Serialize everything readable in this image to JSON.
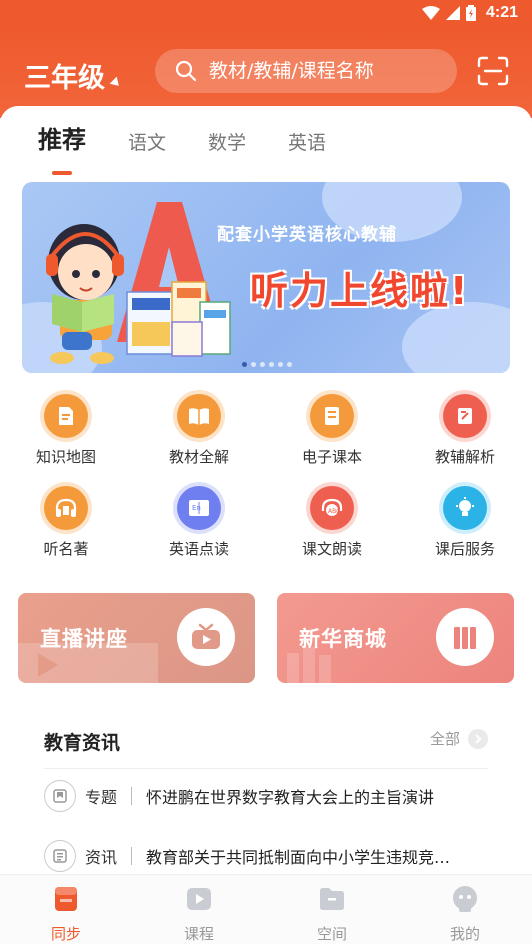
{
  "status_bar": {
    "time": "4:21"
  },
  "header": {
    "grade": "三年级",
    "search_placeholder": "教材/教辅/课程名称"
  },
  "tabs": [
    "推荐",
    "语文",
    "数学",
    "英语"
  ],
  "banner": {
    "subtitle": "配套小学英语核心教辅",
    "title": "听力上线啦!"
  },
  "quick_actions": [
    {
      "label": "知识地图",
      "icon": "knowledge-map-icon",
      "color": "#f59a3b"
    },
    {
      "label": "教材全解",
      "icon": "textbook-explain-icon",
      "color": "#f59a3b"
    },
    {
      "label": "电子课本",
      "icon": "ebook-icon",
      "color": "#f59a3b"
    },
    {
      "label": "教辅解析",
      "icon": "tutorial-analysis-icon",
      "color": "#ef5f4f"
    },
    {
      "label": "听名著",
      "icon": "audiobook-icon",
      "color": "#f59a3b"
    },
    {
      "label": "英语点读",
      "icon": "english-reading-icon",
      "color": "#6f7ff0"
    },
    {
      "label": "课文朗读",
      "icon": "text-recital-icon",
      "color": "#ef5f4f"
    },
    {
      "label": "课后服务",
      "icon": "after-school-service-icon",
      "color": "#2bb3e8"
    }
  ],
  "promos": [
    {
      "label": "直播讲座",
      "icon": "live-tv-icon",
      "color": "#e59a86"
    },
    {
      "label": "新华商城",
      "icon": "bookshelf-icon",
      "color": "#ef8a82"
    }
  ],
  "news": {
    "title": "教育资讯",
    "more": "全部",
    "items": [
      {
        "tag": "专题",
        "icon": "topic-icon",
        "headline": "怀进鹏在世界数字教育大会上的主旨演讲"
      },
      {
        "tag": "资讯",
        "icon": "news-icon",
        "headline": "教育部关于共同抵制面向中小学生违规竞…"
      }
    ]
  },
  "bottom_nav": [
    {
      "label": "同步",
      "icon": "sync-book-icon",
      "active": true
    },
    {
      "label": "课程",
      "icon": "course-play-icon",
      "active": false
    },
    {
      "label": "空间",
      "icon": "folder-space-icon",
      "active": false
    },
    {
      "label": "我的",
      "icon": "profile-icon",
      "active": false
    }
  ]
}
